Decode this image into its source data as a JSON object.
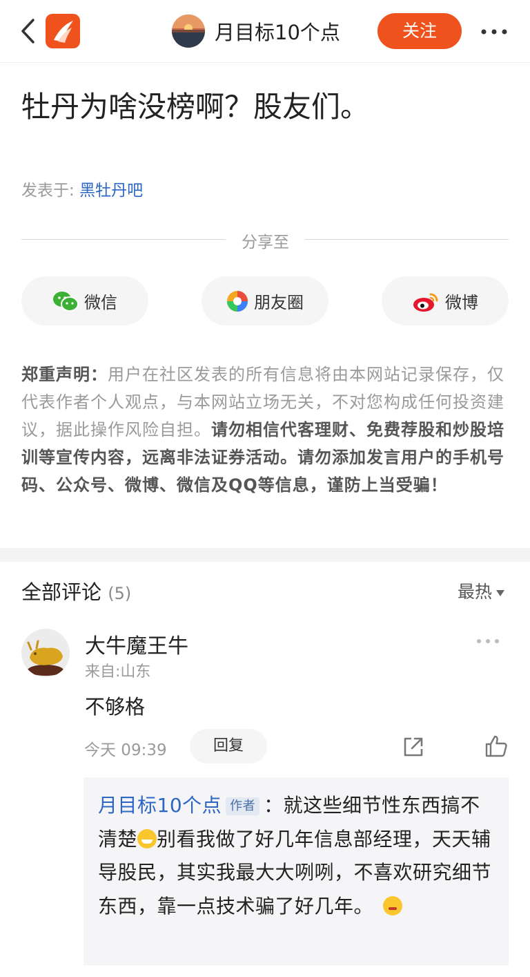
{
  "header": {
    "title": "月目标10个点",
    "follow_label": "关注",
    "icons": [
      "back-icon",
      "app-logo",
      "more-icon"
    ]
  },
  "post": {
    "title": "牡丹为啥没榜啊？股友们。",
    "posted_label": "发表于:",
    "forum": "黑牡丹吧"
  },
  "share": {
    "label": "分享至",
    "buttons": [
      {
        "label": "微信",
        "icon": "wechat-icon"
      },
      {
        "label": "朋友圈",
        "icon": "moments-icon"
      },
      {
        "label": "微博",
        "icon": "weibo-icon"
      }
    ]
  },
  "disclaimer": {
    "heading": "郑重声明：",
    "normal": "用户在社区发表的所有信息将由本网站记录保存，仅代表作者个人观点，与本网站立场无关，不对您构成任何投资建议，据此操作风险自担。",
    "bold": "请勿相信代客理财、免费荐股和炒股培训等宣传内容，远离非法证券活动。请勿添加发言用户的手机号码、公众号、微博、微信及QQ等信息，谨防上当受骗！"
  },
  "comments": {
    "title": "全部评论",
    "count": "(5)",
    "sort": "最热",
    "items": [
      {
        "author": "大牛魔王牛",
        "from": "来自:山东",
        "text": "不够格",
        "time": "今天 09:39",
        "reply_label": "回复",
        "reply": {
          "author": "月目标10个点",
          "tag": "作者",
          "sep": "：",
          "part1": "就这些细节性东西搞不清楚",
          "part2": "别看我做了好几年信息部经理，天天辅导股民，其实我最大大咧咧，不喜欢研究细节东西，靠一点技术骗了好几年。",
          "emojis": [
            "grin-emoji",
            "hand-over-mouth-emoji"
          ]
        }
      }
    ]
  },
  "colors": {
    "accent": "#f0521e",
    "link": "#2b66c4",
    "muted": "#9a9a9a"
  }
}
